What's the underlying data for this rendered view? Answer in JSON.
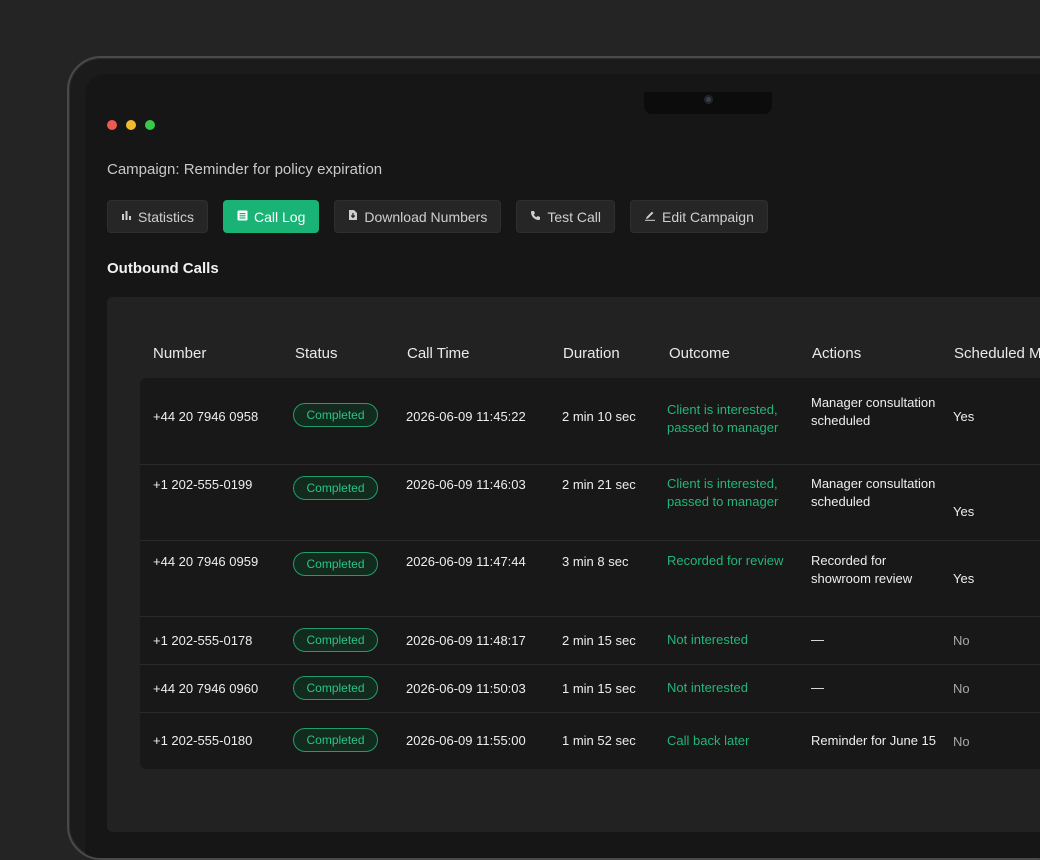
{
  "campaign": {
    "title": "Campaign: Reminder for policy expiration"
  },
  "toolbar": {
    "buttons": [
      {
        "label": "Statistics",
        "icon": "bar-chart-icon",
        "active": false
      },
      {
        "label": "Call Log",
        "icon": "list-icon",
        "active": true
      },
      {
        "label": "Download Numbers",
        "icon": "download-icon",
        "active": false
      },
      {
        "label": "Test Call",
        "icon": "phone-icon",
        "active": false
      },
      {
        "label": "Edit Campaign",
        "icon": "edit-icon",
        "active": false
      }
    ]
  },
  "section": {
    "title": "Outbound Calls"
  },
  "table": {
    "headers": [
      "Number",
      "Status",
      "Call Time",
      "Duration",
      "Outcome",
      "Actions",
      "Scheduled M"
    ],
    "rows": [
      {
        "number": "+44 20 7946 0958",
        "status": "Completed",
        "call_time": "2026-06-09 11:45:22",
        "duration": "2 min 10 sec",
        "outcome": "Client is interested, passed to manager",
        "actions": "Manager consultation scheduled",
        "scheduled": "Yes"
      },
      {
        "number": "+1 202-555-0199",
        "status": "Completed",
        "call_time": "2026-06-09 11:46:03",
        "duration": "2 min 21 sec",
        "outcome": "Client is interested, passed to manager",
        "actions": "Manager consultation scheduled",
        "scheduled": "Yes"
      },
      {
        "number": "+44 20 7946 0959",
        "status": "Completed",
        "call_time": "2026-06-09 11:47:44",
        "duration": "3 min 8 sec",
        "outcome": "Recorded for review",
        "actions": "Recorded for showroom review",
        "scheduled": "Yes"
      },
      {
        "number": "+1 202-555-0178",
        "status": "Completed",
        "call_time": "2026-06-09 11:48:17",
        "duration": "2 min 15 sec",
        "outcome": "Not interested",
        "actions": "—",
        "scheduled": "No"
      },
      {
        "number": "+44 20 7946 0960",
        "status": "Completed",
        "call_time": "2026-06-09 11:50:03",
        "duration": "1 min 15 sec",
        "outcome": "Not interested",
        "actions": "—",
        "scheduled": "No"
      },
      {
        "number": "+1 202-555-0180",
        "status": "Completed",
        "call_time": "2026-06-09 11:55:00",
        "duration": "1 min 52 sec",
        "outcome": "Call back later",
        "actions": "Reminder for June 15",
        "scheduled": "No"
      }
    ]
  },
  "colors": {
    "accent": "#19b376",
    "status_green": "#2cc385",
    "background": "#161616"
  }
}
